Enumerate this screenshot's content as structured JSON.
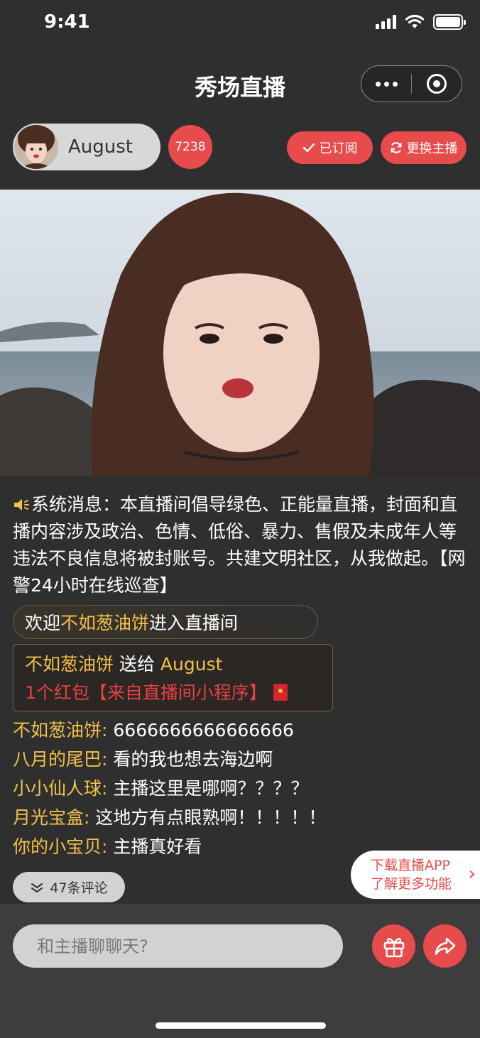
{
  "status_bar": {
    "time": "9:41"
  },
  "header": {
    "title": "秀场直播"
  },
  "anchor": {
    "name": "August",
    "viewer_count": "7238",
    "subscribe_label": "已订阅",
    "switch_label": "更换主播"
  },
  "system_message": {
    "prefix": "系统消息：",
    "text": "本直播间倡导绿色、正能量直播，封面和直播内容涉及政治、色情、低俗、暴力、售假及未成年人等违法不良信息将被封账号。共建文明社区，从我做起。【网警24小时在线巡查】"
  },
  "welcome": {
    "pre": "欢迎 ",
    "user": "不如葱油饼",
    "post": "进入直播间"
  },
  "gift": {
    "sender": "不如葱油饼",
    "verb": " 送给 ",
    "receiver": "August",
    "detail": "1个红包【来自直播间小程序】"
  },
  "comments": [
    {
      "user": "不如葱油饼:",
      "text": " 6666666666666666"
    },
    {
      "user": "八月的尾巴:",
      "text": " 看的我也想去海边啊"
    },
    {
      "user": "小小仙人球:",
      "text": " 主播这里是哪啊？？？？"
    },
    {
      "user": "月光宝盒:",
      "text": " 这地方有点眼熟啊！！！！！"
    },
    {
      "user": "你的小宝贝:",
      "text": " 主播真好看"
    }
  ],
  "more_comments_label": "47条评论",
  "promo": {
    "line1": "下载直播APP",
    "line2": "了解更多功能"
  },
  "chat": {
    "placeholder": "和主播聊聊天?"
  },
  "colors": {
    "accent": "#e84b4b",
    "highlight": "#f3c14a",
    "background": "#2f2f2f"
  }
}
